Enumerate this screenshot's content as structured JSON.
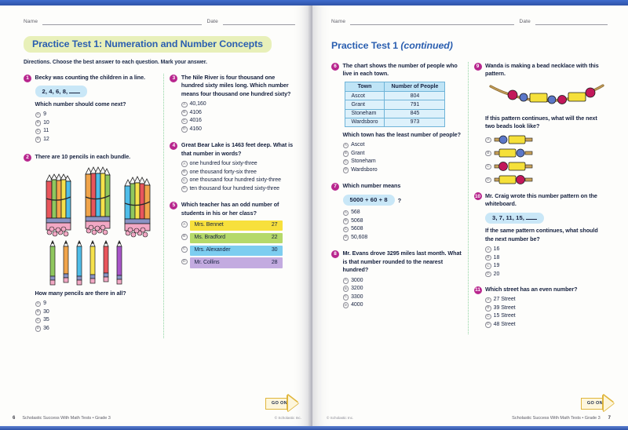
{
  "book": {
    "footer_citation": "Scholastic Success With Math Tests • Grade 3",
    "copyright": "© Scholastic Inc.",
    "left_page_number": "6",
    "right_page_number": "7"
  },
  "labels": {
    "name": "Name",
    "date": "Date"
  },
  "left_page": {
    "title": "Practice Test 1: Numeration and Number Concepts",
    "directions": "Directions. Choose the best answer to each question. Mark your answer.",
    "go_on": "GO ON"
  },
  "right_page": {
    "title_main": "Practice Test 1",
    "title_cont": "(continued)",
    "go_on": "GO ON"
  },
  "questions": [
    {
      "number": "1",
      "text": "Becky was counting the children in a line.",
      "pill": "2, 4, 6, 8,",
      "pill_blank": true,
      "followup": "Which number should come next?",
      "options": [
        {
          "letter": "A",
          "text": "9"
        },
        {
          "letter": "B",
          "text": "10"
        },
        {
          "letter": "C",
          "text": "11"
        },
        {
          "letter": "D",
          "text": "12"
        }
      ]
    },
    {
      "number": "2",
      "text": "There are 10 pencils in each bundle.",
      "art": "pencil-bundles",
      "bundle_count": 3,
      "pencils_per_bundle": "10",
      "loose_pencils": 6,
      "loose_pencil_colors": [
        "#8fc75e",
        "#f0a44a",
        "#4fbde8",
        "#f5e14b",
        "#e8565c",
        "#a855c8"
      ],
      "followup": "How many pencils are there in all?",
      "options": [
        {
          "letter": "A",
          "text": "9"
        },
        {
          "letter": "B",
          "text": "30"
        },
        {
          "letter": "C",
          "text": "35"
        },
        {
          "letter": "D",
          "text": "36"
        }
      ]
    },
    {
      "number": "3",
      "text": "The Nile River is four thousand one hundred sixty miles long. Which number means four thousand one hundred sixty?",
      "options": [
        {
          "letter": "A",
          "text": "40,160"
        },
        {
          "letter": "B",
          "text": "4106"
        },
        {
          "letter": "C",
          "text": "4016"
        },
        {
          "letter": "D",
          "text": "4160"
        }
      ]
    },
    {
      "number": "4",
      "text": "Great Bear Lake is 1463 feet deep. What is that number in words?",
      "options": [
        {
          "letter": "A",
          "text": "one hundred four sixty-three"
        },
        {
          "letter": "B",
          "text": "one thousand forty-six three"
        },
        {
          "letter": "C",
          "text": "one thousand four hundred sixty-three"
        },
        {
          "letter": "D",
          "text": "ten thousand four hundred sixty-three"
        }
      ]
    },
    {
      "number": "5",
      "text": "Which teacher has an odd number of students in his or her class?",
      "bar_options": [
        {
          "letter": "A",
          "name": "Mrs. Bennet",
          "value": "27",
          "color": "#f7e03c"
        },
        {
          "letter": "B",
          "name": "Ms. Bradford",
          "value": "22",
          "color": "#b5d96a"
        },
        {
          "letter": "C",
          "name": "Mrs. Alexander",
          "value": "30",
          "color": "#7dcdf0"
        },
        {
          "letter": "D",
          "name": "Mr. Collins",
          "value": "28",
          "color": "#c3abe0"
        }
      ]
    },
    {
      "number": "6",
      "text": "The chart shows the number of people who live in each town.",
      "table": {
        "headers": [
          "Town",
          "Number of People"
        ],
        "rows": [
          [
            "Ascot",
            "804"
          ],
          [
            "Grant",
            "791"
          ],
          [
            "Stoneham",
            "845"
          ],
          [
            "Wardsboro",
            "973"
          ]
        ]
      },
      "followup": "Which town has the least number of people?",
      "options": [
        {
          "letter": "A",
          "text": "Ascot"
        },
        {
          "letter": "B",
          "text": "Grant"
        },
        {
          "letter": "C",
          "text": "Stoneham"
        },
        {
          "letter": "D",
          "text": "Wardsboro"
        }
      ]
    },
    {
      "number": "7",
      "text": "Which number means",
      "pill": "5000 + 60 + 8",
      "pill_suffix": "?",
      "options": [
        {
          "letter": "A",
          "text": "568"
        },
        {
          "letter": "B",
          "text": "5068"
        },
        {
          "letter": "C",
          "text": "5608"
        },
        {
          "letter": "D",
          "text": "50,608"
        }
      ]
    },
    {
      "number": "8",
      "text": "Mr. Evans drove 3295 miles last month. What is that number rounded to the nearest hundred?",
      "options": [
        {
          "letter": "A",
          "text": "3000"
        },
        {
          "letter": "B",
          "text": "3200"
        },
        {
          "letter": "C",
          "text": "3300"
        },
        {
          "letter": "D",
          "text": "4000"
        }
      ]
    },
    {
      "number": "9",
      "text": "Wanda is making a bead necklace with this pattern.",
      "art": "bead-necklace",
      "pattern_sequence": [
        "magenta-round",
        "blue-round",
        "yellow-rect",
        "blue-round",
        "magenta-round",
        "yellow-rect",
        "magenta-round"
      ],
      "followup": "If this pattern continues, what will the next two beads look like?",
      "bead_options": [
        {
          "letter": "A",
          "beads": [
            "blue-round",
            "yellow-rect"
          ]
        },
        {
          "letter": "B",
          "beads": [
            "yellow-rect",
            "blue-round"
          ]
        },
        {
          "letter": "C",
          "beads": [
            "magenta-round",
            "yellow-rect"
          ]
        },
        {
          "letter": "D",
          "beads": [
            "yellow-rect",
            "magenta-round"
          ]
        }
      ]
    },
    {
      "number": "10",
      "text": "Mr. Craig wrote this number pattern on the whiteboard.",
      "pill": "3, 7, 11, 15,",
      "pill_blank": true,
      "followup": "If the same pattern continues, what should the next number be?",
      "options": [
        {
          "letter": "A",
          "text": "16"
        },
        {
          "letter": "B",
          "text": "18"
        },
        {
          "letter": "C",
          "text": "19"
        },
        {
          "letter": "D",
          "text": "20"
        }
      ]
    },
    {
      "number": "11",
      "text": "Which street has an even number?",
      "options": [
        {
          "letter": "A",
          "text": "27 Street"
        },
        {
          "letter": "B",
          "text": "39 Street"
        },
        {
          "letter": "C",
          "text": "15 Street"
        },
        {
          "letter": "D",
          "text": "48 Street"
        }
      ]
    }
  ],
  "colors": {
    "accent_magenta": "#b8268e",
    "title_blue": "#2b5fb0",
    "highlight_green": "#e8f0b9",
    "pill_blue": "#c9e7f7",
    "table_header": "#bfe4f6",
    "bead_magenta": "#c2185b",
    "bead_blue": "#5b77c8",
    "bead_yellow": "#f5e03a",
    "goon_gold": "#e0b63c"
  }
}
